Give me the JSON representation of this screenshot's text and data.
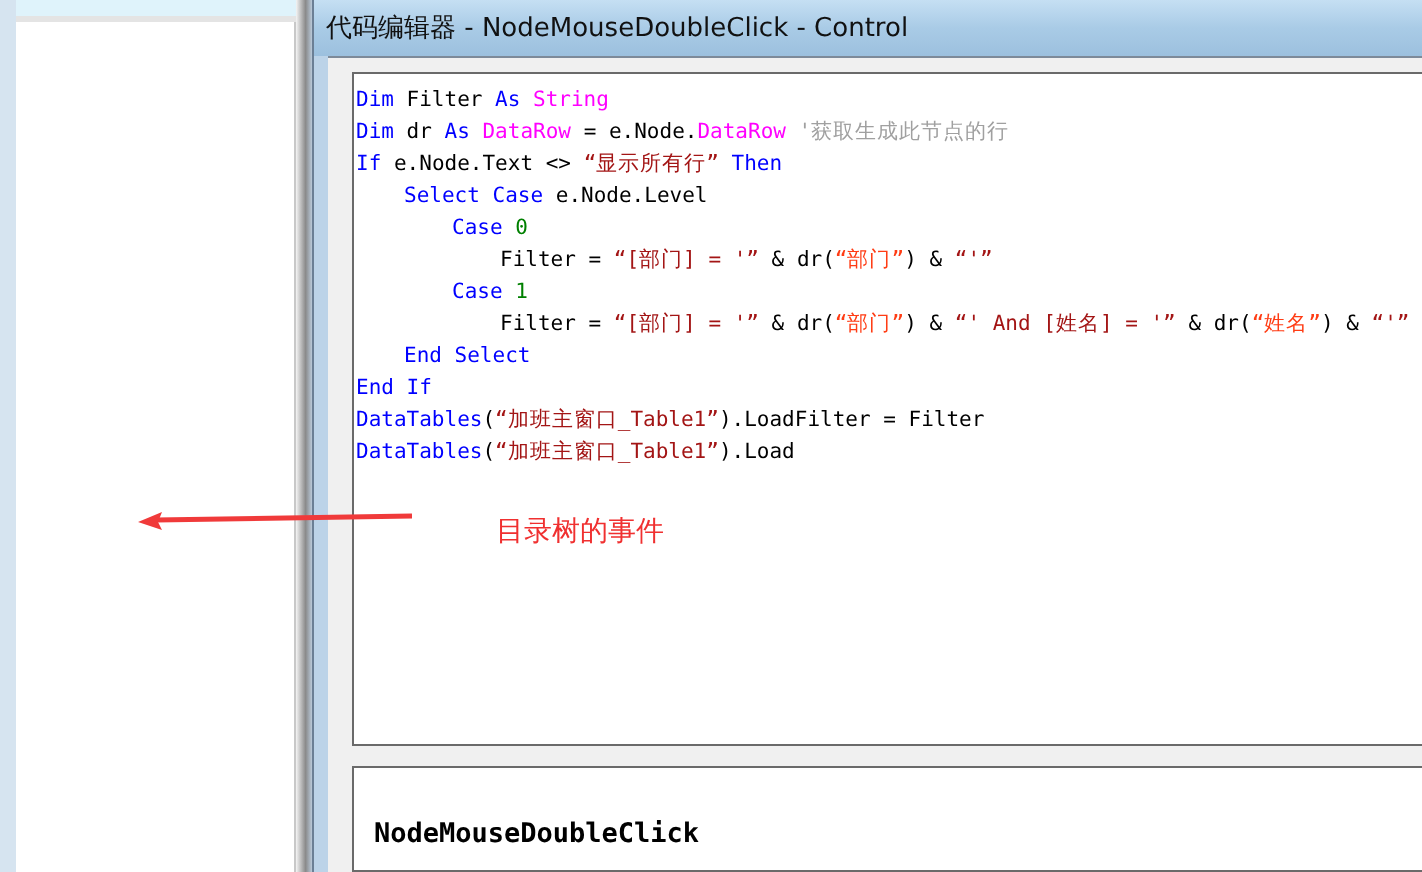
{
  "window": {
    "title": "代码编辑器 - NodeMouseDoubleClick - Control"
  },
  "code_lines": [
    {
      "tokens": [
        {
          "kind": "keyword",
          "text": "Dim"
        },
        {
          "kind": "plain",
          "text": " Filter "
        },
        {
          "kind": "keyword",
          "text": "As "
        },
        {
          "kind": "type",
          "text": "String"
        }
      ]
    },
    {
      "tokens": [
        {
          "kind": "keyword",
          "text": "Dim"
        },
        {
          "kind": "plain",
          "text": " dr "
        },
        {
          "kind": "keyword",
          "text": "As "
        },
        {
          "kind": "type",
          "text": "DataRow"
        },
        {
          "kind": "plain",
          "text": " = e.Node."
        },
        {
          "kind": "type",
          "text": "DataRow"
        },
        {
          "kind": "comment",
          "text": " '获取生成此节点的行"
        }
      ]
    },
    {
      "tokens": [
        {
          "kind": "keyword",
          "text": "If"
        },
        {
          "kind": "plain",
          "text": " e.Node.Text <> "
        },
        {
          "kind": "string",
          "text": "“显示所有行”"
        },
        {
          "kind": "keyword",
          "text": " Then"
        }
      ],
      "children": [
        {
          "tokens": [
            {
              "kind": "keyword",
              "text": "Select Case"
            },
            {
              "kind": "plain",
              "text": " e.Node.Level"
            }
          ],
          "children": [
            {
              "tokens": [
                {
                  "kind": "keyword",
                  "text": "Case "
                },
                {
                  "kind": "number",
                  "text": "0"
                }
              ],
              "children": [
                {
                  "tokens": [
                    {
                      "kind": "plain",
                      "text": "Filter = "
                    },
                    {
                      "kind": "string",
                      "text": "“[部门] = '”"
                    },
                    {
                      "kind": "plain",
                      "text": " & dr("
                    },
                    {
                      "kind": "argument",
                      "text": "“部门”"
                    },
                    {
                      "kind": "plain",
                      "text": ") & "
                    },
                    {
                      "kind": "string",
                      "text": "“'”"
                    }
                  ]
                }
              ]
            },
            {
              "tokens": [
                {
                  "kind": "keyword",
                  "text": "Case "
                },
                {
                  "kind": "number",
                  "text": "1"
                }
              ],
              "children": [
                {
                  "tokens": [
                    {
                      "kind": "plain",
                      "text": "Filter = "
                    },
                    {
                      "kind": "string",
                      "text": "“[部门] = '”"
                    },
                    {
                      "kind": "plain",
                      "text": " & dr("
                    },
                    {
                      "kind": "argument",
                      "text": "“部门”"
                    },
                    {
                      "kind": "plain",
                      "text": ") & "
                    },
                    {
                      "kind": "string",
                      "text": "“' And [姓名] = '”"
                    },
                    {
                      "kind": "plain",
                      "text": " & dr("
                    },
                    {
                      "kind": "argument",
                      "text": "“姓名”"
                    },
                    {
                      "kind": "plain",
                      "text": ") & "
                    },
                    {
                      "kind": "string",
                      "text": "“'”"
                    }
                  ]
                }
              ]
            }
          ]
        },
        {
          "tokens": [
            {
              "kind": "keyword",
              "text": "End Select"
            }
          ]
        }
      ]
    },
    {
      "tokens": [
        {
          "kind": "keyword",
          "text": "End If"
        }
      ]
    },
    {
      "tokens": [
        {
          "kind": "keyword",
          "text": "DataTables"
        },
        {
          "kind": "plain",
          "text": "("
        },
        {
          "kind": "string",
          "text": "“加班主窗口_Table1”"
        },
        {
          "kind": "plain",
          "text": ").LoadFilter = Filter"
        }
      ]
    },
    {
      "tokens": [
        {
          "kind": "keyword",
          "text": "DataTables"
        },
        {
          "kind": "plain",
          "text": "("
        },
        {
          "kind": "string",
          "text": "“加班主窗口_Table1”"
        },
        {
          "kind": "plain",
          "text": ").Load"
        }
      ]
    }
  ],
  "annotation": {
    "text": "目录树的事件"
  },
  "event_name": "NodeMouseDoubleClick"
}
